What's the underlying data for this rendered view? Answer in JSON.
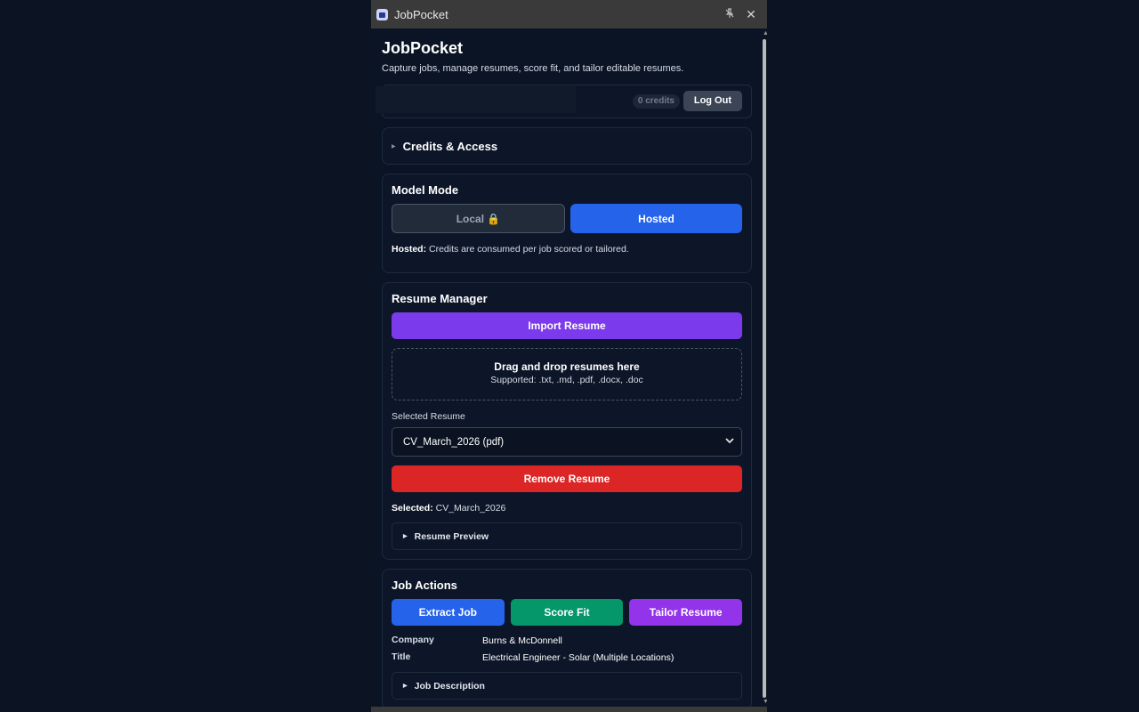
{
  "window": {
    "title": "JobPocket"
  },
  "header": {
    "title": "JobPocket",
    "subtitle": "Capture jobs, manage resumes, score fit, and tailor editable resumes."
  },
  "account": {
    "credits_label": "0 credits",
    "logout_label": "Log Out"
  },
  "credits_access": {
    "title": "Credits & Access"
  },
  "model_mode": {
    "title": "Model Mode",
    "local_label": "Local 🔒",
    "hosted_label": "Hosted",
    "hint_bold": "Hosted:",
    "hint_text": " Credits are consumed per job scored or tailored."
  },
  "resume_manager": {
    "title": "Resume Manager",
    "import_label": "Import Resume",
    "dropzone_title": "Drag and drop resumes here",
    "dropzone_sub": "Supported: .txt, .md, .pdf, .docx, .doc",
    "selected_label": "Selected Resume",
    "selected_value": "CV_March_2026 (pdf)",
    "remove_label": "Remove Resume",
    "selected_line_bold": "Selected:",
    "selected_line_value": " CV_March_2026",
    "preview_label": "Resume Preview"
  },
  "job_actions": {
    "title": "Job Actions",
    "extract_label": "Extract Job",
    "score_label": "Score Fit",
    "tailor_label": "Tailor Resume",
    "company_key": "Company",
    "company_value": "Burns & McDonnell",
    "title_key": "Title",
    "title_value": "Electrical Engineer - Solar (Multiple Locations)",
    "description_label": "Job Description"
  },
  "colors": {
    "primary": "#2563eb",
    "purple": "#7c3aed",
    "danger": "#dc2626",
    "success": "#059669",
    "background": "#0b1424"
  }
}
